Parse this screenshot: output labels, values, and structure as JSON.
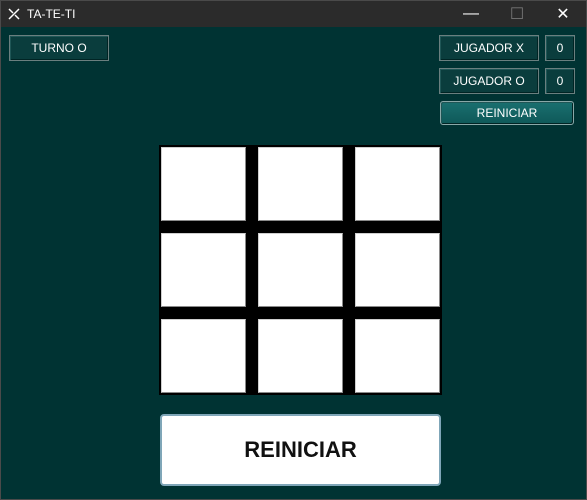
{
  "window": {
    "title": "TA-TE-TI",
    "icon": "tic-tac-toe-icon",
    "controls": {
      "minimize": "—",
      "maximize": "☐",
      "close": "✕"
    }
  },
  "status": {
    "turn_label": "TURNO O"
  },
  "scoreboard": {
    "player_x_label": "JUGADOR X",
    "player_x_score": "0",
    "player_o_label": "JUGADOR O",
    "player_o_score": "0"
  },
  "controls": {
    "reset_small_label": "REINICIAR",
    "reset_big_label": "REINICIAR"
  },
  "board": {
    "cells": [
      "",
      "",
      "",
      "",
      "",
      "",
      "",
      "",
      ""
    ]
  },
  "colors": {
    "background": "#003333",
    "titlebar": "#2b2b2b",
    "button_dark": "#0a3d3d",
    "board_grid": "#000000",
    "cell": "#ffffff"
  }
}
